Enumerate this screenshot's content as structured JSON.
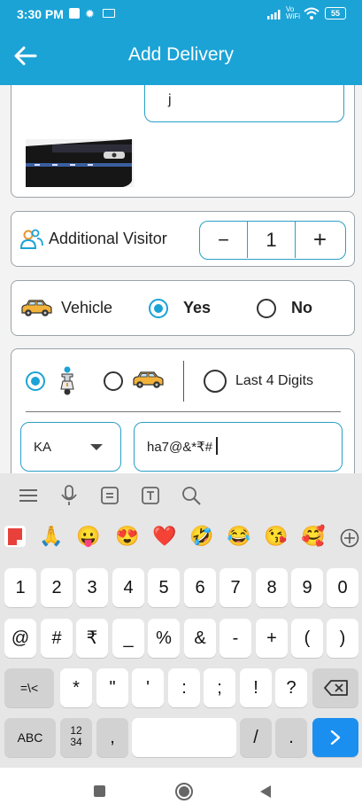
{
  "status_bar": {
    "time": "3:30 PM",
    "battery": "55",
    "network_label": "Vo WiFi"
  },
  "header": {
    "title": "Add Delivery"
  },
  "form": {
    "note_value": "j",
    "additional_visitor": {
      "label": "Additional Visitor",
      "count": "1",
      "minus": "−",
      "plus": "+"
    },
    "vehicle": {
      "label": "Vehicle",
      "yes": "Yes",
      "no": "No",
      "selected": "Yes"
    },
    "vehicle_number": {
      "last4_label": "Last 4 Digits",
      "state_value": "KA",
      "number_value": "ha7@&*₹#"
    }
  },
  "keyboard": {
    "emojis": [
      "🙏",
      "😛",
      "😍",
      "❤️",
      "🤣",
      "😂",
      "😘",
      "🥰"
    ],
    "row1": [
      "1",
      "2",
      "3",
      "4",
      "5",
      "6",
      "7",
      "8",
      "9",
      "0"
    ],
    "row2": [
      "@",
      "#",
      "₹",
      "_",
      "%",
      "&",
      "-",
      "+",
      "(",
      ")"
    ],
    "row3": [
      "=\\<",
      "*",
      "\"",
      "'",
      ":",
      ";",
      "!",
      "?"
    ],
    "row4": {
      "abc": "ABC",
      "num_top": "12",
      "num_bottom": "34",
      "comma": ",",
      "slash": "/",
      "period": "."
    }
  },
  "colors": {
    "primary": "#1ba3d6",
    "border": "#2a9fc6"
  }
}
